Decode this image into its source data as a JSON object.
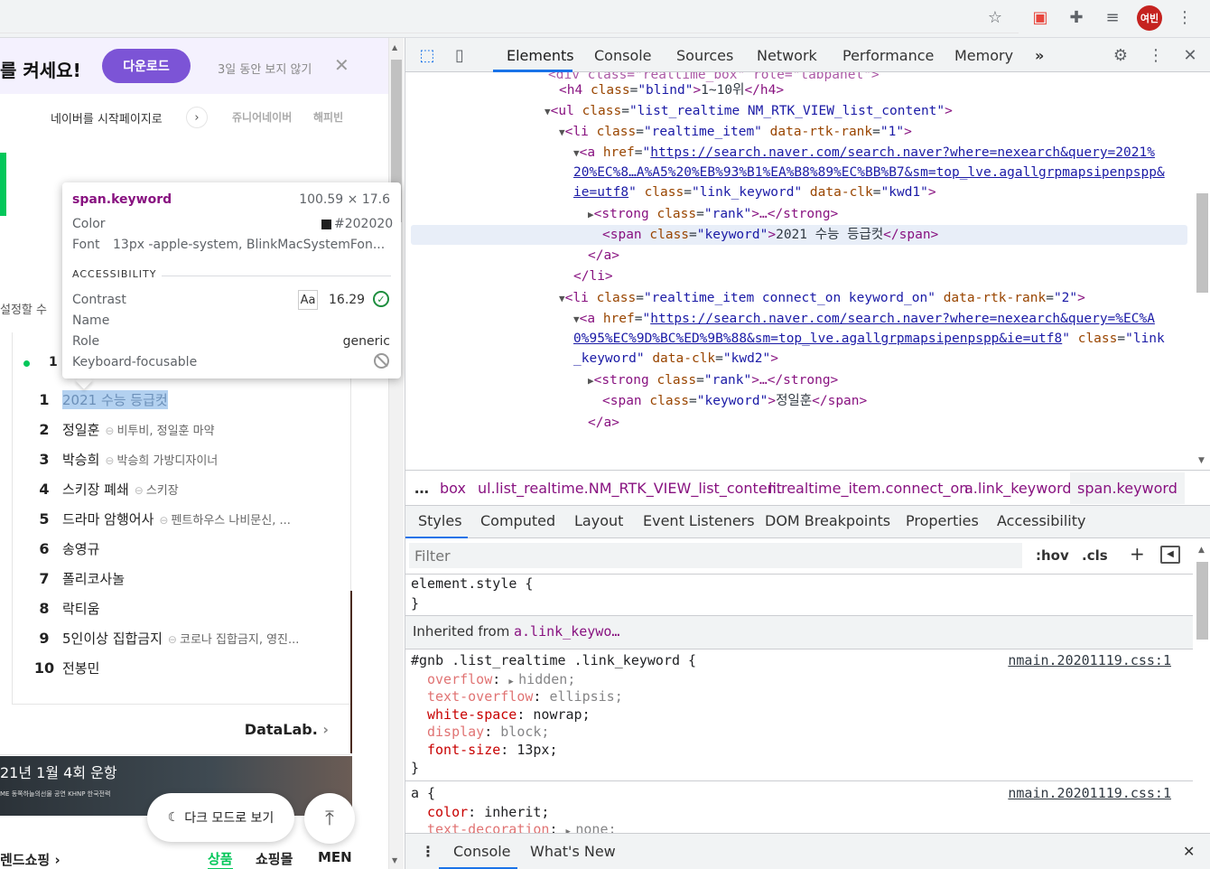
{
  "browser": {
    "avatar_label": "여빈"
  },
  "page": {
    "banner": {
      "text": "를 켜세요!",
      "download_label": "다운로드",
      "hide_label": "3일 동안 보지 않기"
    },
    "start_page_link": "네이버를 시작페이지로",
    "junior_naver": "쥬니어네이버",
    "happybean": "해피빈",
    "set_text": "설정할 수",
    "rank_head": "1",
    "ranking": [
      {
        "rank": "1",
        "keyword": "2021 수능 등급컷",
        "related": ""
      },
      {
        "rank": "2",
        "keyword": "정일훈",
        "related": "비투비, 정일훈 마약"
      },
      {
        "rank": "3",
        "keyword": "박승희",
        "related": "박승희 가방디자이너"
      },
      {
        "rank": "4",
        "keyword": "스키장 폐쇄",
        "related": "스키장"
      },
      {
        "rank": "5",
        "keyword": "드라마 암행어사",
        "related": "펜트하우스 나비문신, ..."
      },
      {
        "rank": "6",
        "keyword": "송영규",
        "related": ""
      },
      {
        "rank": "7",
        "keyword": "폴리코사놀",
        "related": ""
      },
      {
        "rank": "8",
        "keyword": "락티움",
        "related": ""
      },
      {
        "rank": "9",
        "keyword": "5인이상 집합금지",
        "related": "코로나 집합금지, 영진..."
      },
      {
        "rank": "10",
        "keyword": "전봉민",
        "related": ""
      }
    ],
    "datalab": "DataLab.",
    "ad_date": "21년 1월 4회 운항",
    "ad_sub": "ME 동쪽하늘의선물 공연 KHNP 한국전력",
    "dark_mode_label": "다크 모드로 보기",
    "shopping_label": "렌드쇼핑",
    "shop_tabs": [
      "상품",
      "쇼핑몰",
      "MEN"
    ]
  },
  "tooltip": {
    "selector": "span.keyword",
    "dimensions": "100.59 × 17.6",
    "color_label": "Color",
    "color_value": "#202020",
    "font_label": "Font",
    "font_value": "13px -apple-system, BlinkMacSystemFon...",
    "accessibility_heading": "ACCESSIBILITY",
    "contrast_label": "Contrast",
    "contrast_aa": "Aa",
    "contrast_value": "16.29",
    "name_label": "Name",
    "role_label": "Role",
    "role_value": "generic",
    "focusable_label": "Keyboard-focusable"
  },
  "devtools": {
    "tabs": [
      "Elements",
      "Console",
      "Sources",
      "Network",
      "Performance",
      "Memory"
    ],
    "more_tabs": "»",
    "dom": {
      "l0_tag": "<div class=\"realtime_box\" role=\"tabpanel\">",
      "l1_open": "<h4",
      "l1_attr": "class",
      "l1_val": "\"blind\"",
      "l1_text": "1~10위",
      "l1_close": "</h4>",
      "l2_open": "<ul",
      "l2_attr": "class",
      "l2_val": "\"list_realtime NM_RTK_VIEW_list_content\"",
      "l3_open": "<li",
      "l3_attr1": "class",
      "l3_val1": "\"realtime_item\"",
      "l3_attr2": "data-rtk-rank",
      "l3_val2": "\"1\"",
      "l4_open": "<a",
      "l4_attr": "href",
      "l4_link1": "https://search.naver.com/search.naver?where=nexearch&query=2021%",
      "l5_link2": "20%EC%8…A%A5%20%EB%93%B1%EA%B8%89%EC%BB%B7&sm=top_lve.agallgrpmapsipenpspp&",
      "l6_link3": "ie=utf8",
      "l6_attr2": "class",
      "l6_val2": "\"link_keyword\"",
      "l6_attr3": "data-clk",
      "l6_val3": "\"kwd1\"",
      "l7_open": "<strong",
      "l7_attr": "class",
      "l7_val": "\"rank\"",
      "l7_rest": "…</strong>",
      "l8_open": "<span",
      "l8_attr": "class",
      "l8_val": "\"keyword\"",
      "l8_text": "2021 수능 등급컷",
      "l8_close": "</span>",
      "l9": "</a>",
      "l10": "</li>",
      "l11_open": "<li",
      "l11_attr1": "class",
      "l11_val1": "\"realtime_item connect_on keyword_on\"",
      "l11_attr2": "data-rtk-rank",
      "l11_val2": "\"2\"",
      "l12_open": "<a",
      "l12_attr": "href",
      "l12_link1": "https://search.naver.com/search.naver?where=nexearch&query=%EC%A",
      "l13_link2": "0%95%EC%9D%BC%ED%9B%88&sm=top_lve.agallgrpmapsipenpspp&ie=utf8",
      "l13_attr2": "class",
      "l13_val2_start": "\"link",
      "l14_val2_end": "_keyword\"",
      "l14_attr3": "data-clk",
      "l14_val3": "\"kwd2\"",
      "l15_open": "<strong",
      "l15_attr": "class",
      "l15_val": "\"rank\"",
      "l15_rest": "…</strong>",
      "l16_open": "<span",
      "l16_attr": "class",
      "l16_val": "\"keyword\"",
      "l16_text": "정일훈",
      "l16_close": "</span>",
      "l17": "</a>"
    },
    "breadcrumbs": [
      "box",
      "ul.list_realtime.NM_RTK_VIEW_list_content",
      "li.realtime_item.connect_on",
      "a.link_keyword",
      "span.keyword"
    ],
    "styles_tabs": [
      "Styles",
      "Computed",
      "Layout",
      "Event Listeners",
      "DOM Breakpoints",
      "Properties",
      "Accessibility"
    ],
    "filter_placeholder": "Filter",
    "hov": ":hov",
    "cls": ".cls",
    "styles": {
      "element_style": "element.style {",
      "close_brace": "}",
      "inherited_label": "Inherited from",
      "inherited_from": "a.link_keywo…",
      "rule1_selector": "#gnb .list_realtime .link_keyword {",
      "rule1_source": "nmain.20201119.css:1",
      "rule1_props": [
        {
          "name": "overflow",
          "value": "hidden;",
          "dim": true,
          "arrow": true
        },
        {
          "name": "text-overflow",
          "value": "ellipsis;",
          "dim": true,
          "arrow": false
        },
        {
          "name": "white-space",
          "value": "nowrap;",
          "dim": false,
          "arrow": false
        },
        {
          "name": "display",
          "value": "block;",
          "dim": true,
          "arrow": false
        },
        {
          "name": "font-size",
          "value": "13px;",
          "dim": false,
          "arrow": false
        }
      ],
      "rule2_selector": "a {",
      "rule2_source": "nmain.20201119.css:1",
      "rule2_props": [
        {
          "name": "color",
          "value": "inherit;",
          "dim": false,
          "arrow": false
        },
        {
          "name": "text-decoration",
          "value": "none;",
          "dim": true,
          "arrow": true
        }
      ]
    },
    "drawer_tabs": [
      "Console",
      "What's New"
    ]
  }
}
